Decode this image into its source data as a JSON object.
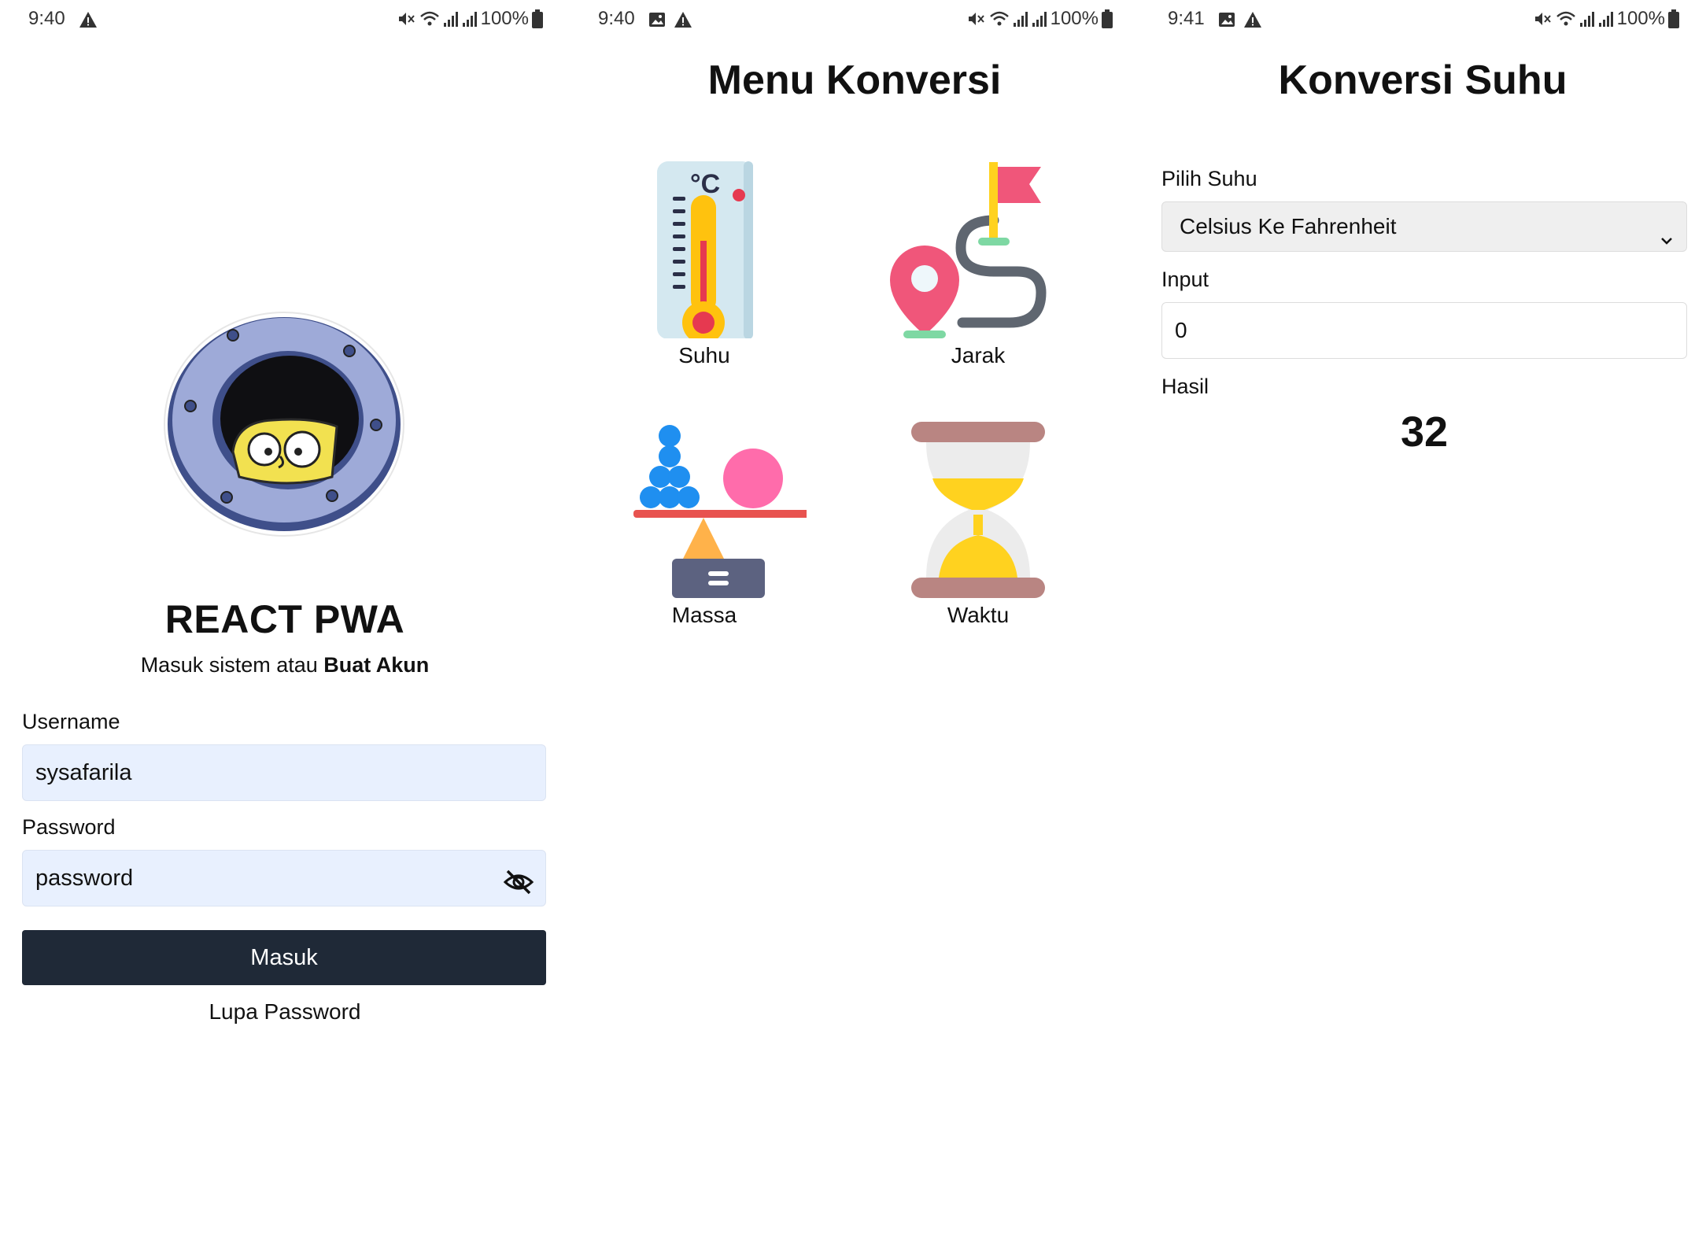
{
  "status_bars": [
    {
      "time": "9:40",
      "battery": "100%"
    },
    {
      "time": "9:40",
      "battery": "100%"
    },
    {
      "time": "9:41",
      "battery": "100%"
    }
  ],
  "login": {
    "app_title": "REACT PWA",
    "subtitle_prefix": "Masuk sistem atau",
    "subtitle_link": "Buat Akun",
    "username_label": "Username",
    "username_value": "sysafarila",
    "password_label": "Password",
    "password_value": "password",
    "submit_label": "Masuk",
    "forgot_label": "Lupa Password",
    "logo_icon": "spongebob-porthole-logo",
    "password_toggle_icon": "eye-slash-icon"
  },
  "menu": {
    "title": "Menu Konversi",
    "items": [
      {
        "label": "Suhu",
        "icon": "thermometer-icon"
      },
      {
        "label": "Jarak",
        "icon": "route-icon"
      },
      {
        "label": "Massa",
        "icon": "balance-scale-icon"
      },
      {
        "label": "Waktu",
        "icon": "hourglass-icon"
      }
    ],
    "thermometer_unit": "°C"
  },
  "konversi": {
    "title": "Konversi Suhu",
    "select_label": "Pilih Suhu",
    "select_value": "Celsius Ke Fahrenheit",
    "input_label": "Input",
    "input_value": "0",
    "result_label": "Hasil",
    "result_value": "32"
  },
  "colors": {
    "button_bg": "#1f2937",
    "field_bg": "#e8f0fe",
    "select_bg": "#efefef"
  }
}
